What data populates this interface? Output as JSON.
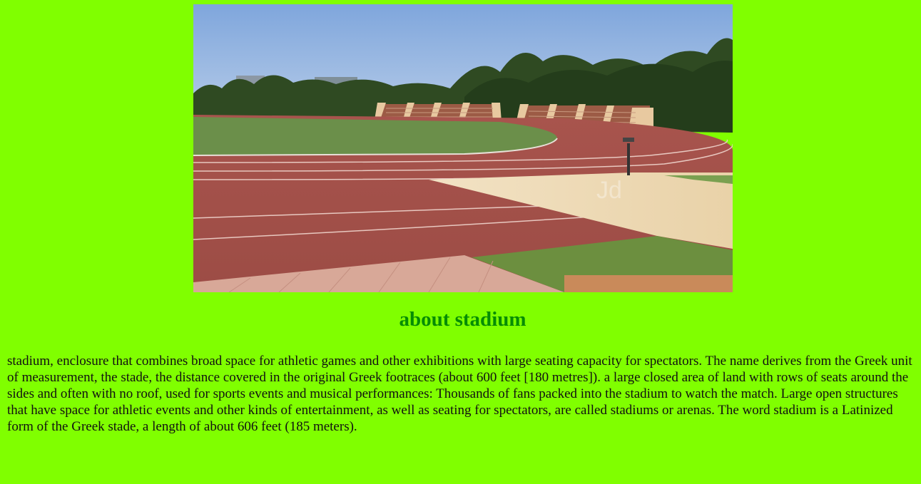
{
  "page": {
    "background_color": "#80ff00",
    "heading_color": "#058c05"
  },
  "image": {
    "alt": "Stadium running track with seating stands",
    "watermark": "Jd"
  },
  "heading": "about stadium",
  "paragraph": "stadium, enclosure that combines broad space for athletic games and other exhibitions with large seating capacity for spectators. The name derives from the Greek unit of measurement, the stade, the distance covered in the original Greek footraces (about 600 feet [180 metres]). a large closed area of land with rows of seats around the sides and often with no roof, used for sports events and musical performances: Thousands of fans packed into the stadium to watch the match. Large open structures that have space for athletic events and other kinds of entertainment, as well as seating for spectators, are called stadiums or arenas. The word stadium is a Latinized form of the Greek stade, a length of about 606 feet (185 meters)."
}
